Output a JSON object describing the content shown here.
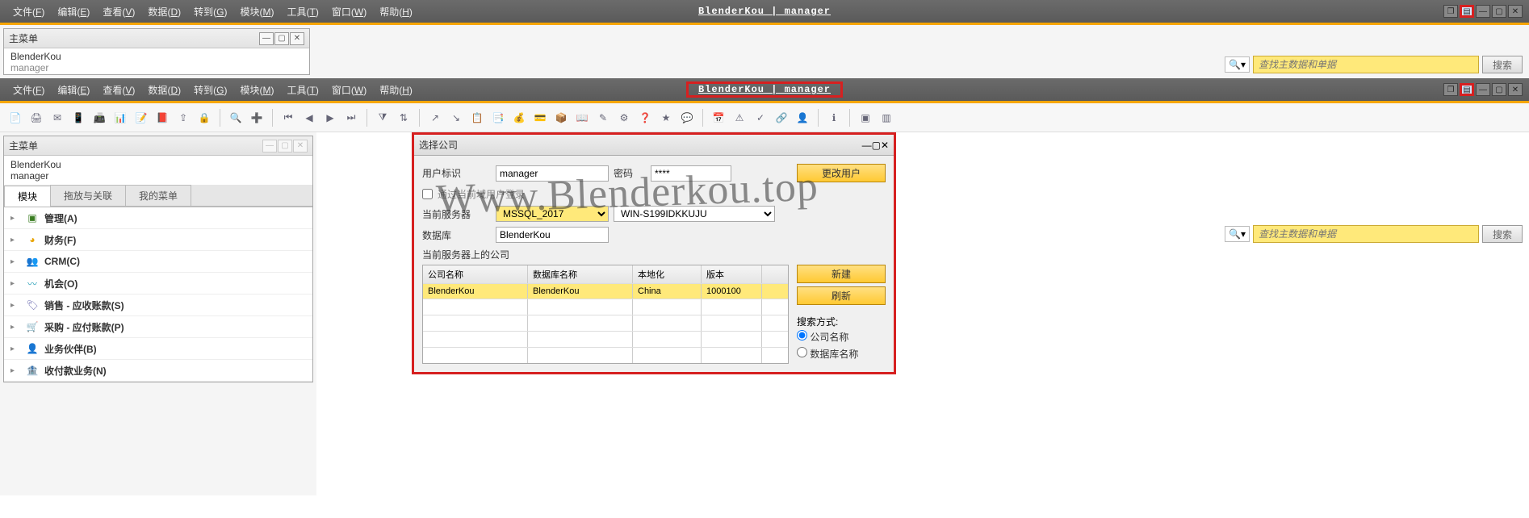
{
  "app_title": "BlenderKou  |  manager",
  "menus": [
    {
      "label": "文件",
      "key": "F"
    },
    {
      "label": "编辑",
      "key": "E"
    },
    {
      "label": "查看",
      "key": "V"
    },
    {
      "label": "数据",
      "key": "D"
    },
    {
      "label": "转到",
      "key": "G"
    },
    {
      "label": "模块",
      "key": "M"
    },
    {
      "label": "工具",
      "key": "T"
    },
    {
      "label": "窗口",
      "key": "W"
    },
    {
      "label": "帮助",
      "key": "H"
    }
  ],
  "main_menu_panel_title": "主菜单",
  "user_line1": "BlenderKou",
  "user_line2": "manager",
  "search_placeholder": "查找主数据和单据",
  "search_button": "搜索",
  "sidebar": {
    "tabs": [
      "模块",
      "拖放与关联",
      "我的菜单"
    ],
    "items": [
      {
        "label": "管理(A)",
        "color": "#3a7d22"
      },
      {
        "label": "财务(F)",
        "color": "#e8a400"
      },
      {
        "label": "CRM(C)",
        "color": "#e8a400"
      },
      {
        "label": "机会(O)",
        "color": "#2aa0b8"
      },
      {
        "label": "销售 - 应收账款(S)",
        "color": "#6b6bb0"
      },
      {
        "label": "采购 - 应付账款(P)",
        "color": "#2a7db8"
      },
      {
        "label": "业务伙伴(B)",
        "color": "#d06030"
      },
      {
        "label": "收付款业务(N)",
        "color": "#e8a400"
      }
    ]
  },
  "dialog": {
    "title": "选择公司",
    "user_id_label": "用户标识",
    "user_id_value": "manager",
    "password_label": "密码",
    "password_value": "****",
    "change_user_btn": "更改用户",
    "domain_login": "通过当前域用户登录",
    "server_label": "当前服务器",
    "server_value": "MSSQL_2017",
    "host_value": "WIN-S199IDKKUJU",
    "db_label": "数据库",
    "db_value": "BlenderKou",
    "grid_title": "当前服务器上的公司",
    "grid_headers": [
      "公司名称",
      "数据库名称",
      "本地化",
      "版本"
    ],
    "grid_row": {
      "company": "BlenderKou",
      "db": "BlenderKou",
      "local": "China",
      "ver": "1000100"
    },
    "new_btn": "新建",
    "refresh_btn": "刷新",
    "search_mode_label": "搜索方式:",
    "radio1": "公司名称",
    "radio2": "数据库名称"
  },
  "watermark": "Www.Blenderkou.top"
}
